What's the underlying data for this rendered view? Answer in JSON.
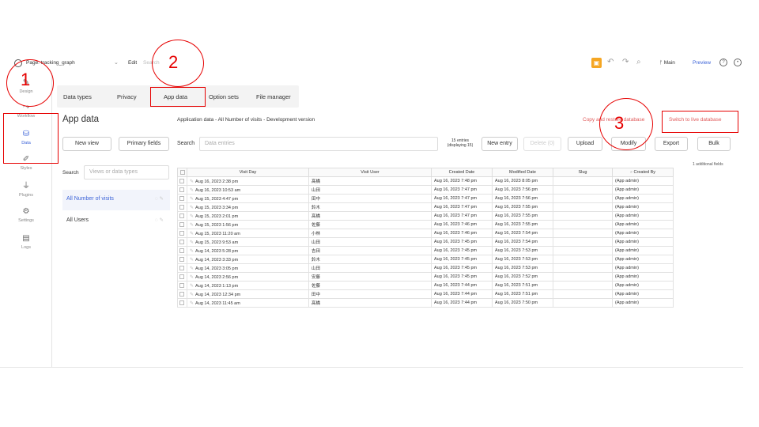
{
  "topbar": {
    "page_label": "Page: tracking_graph",
    "page_select_icon": "chevron-down-icon",
    "edit": "Edit",
    "search": "Search",
    "branch": "Main",
    "preview": "Preview"
  },
  "rail": [
    {
      "label": "Design",
      "icon": "design-icon"
    },
    {
      "label": "Workflow",
      "icon": "workflow-icon"
    },
    {
      "label": "Data",
      "icon": "database-icon"
    },
    {
      "label": "Styles",
      "icon": "brush-icon"
    },
    {
      "label": "Plugins",
      "icon": "plug-icon"
    },
    {
      "label": "Settings",
      "icon": "gear-icon"
    },
    {
      "label": "Logs",
      "icon": "document-icon"
    }
  ],
  "tabs": [
    "Data types",
    "Privacy",
    "App data",
    "Option sets",
    "File manager"
  ],
  "sidebar": {
    "title": "App data",
    "new_view": "New view",
    "primary_fields": "Primary fields",
    "search_label": "Search",
    "search_placeholder": "Views or data types",
    "items": [
      "All Number of visits",
      "All Users"
    ]
  },
  "main": {
    "heading": "Application data - All Number of visits - Development version",
    "copy_link": "Copy and restore database",
    "switch_link": "Switch to live database",
    "search_label": "Search",
    "search_placeholder": "Data entries",
    "entries_count": "15 entries",
    "entries_displaying": "(displaying 15)",
    "buttons": {
      "new_entry": "New entry",
      "delete": "Delete (0)",
      "upload": "Upload",
      "modify": "Modify",
      "export": "Export",
      "bulk": "Bulk"
    },
    "additional_fields": "1 additional fields"
  },
  "table": {
    "columns": [
      "Visit Day",
      "Visit User",
      "Created Date",
      "Modified Date",
      "Slug",
      "Created By"
    ],
    "rows": [
      [
        "Aug 16, 2023 2:38 pm",
        "髙橋",
        "Aug 16, 2023 7:48 pm",
        "Aug 16, 2023 8:05 pm",
        "",
        "(App admin)"
      ],
      [
        "Aug 16, 2023 10:53 am",
        "山田",
        "Aug 16, 2023 7:47 pm",
        "Aug 16, 2023 7:56 pm",
        "",
        "(App admin)"
      ],
      [
        "Aug 15, 2023 4:47 pm",
        "田中",
        "Aug 16, 2023 7:47 pm",
        "Aug 16, 2023 7:56 pm",
        "",
        "(App admin)"
      ],
      [
        "Aug 15, 2023 3:34 pm",
        "鈴木",
        "Aug 16, 2023 7:47 pm",
        "Aug 16, 2023 7:55 pm",
        "",
        "(App admin)"
      ],
      [
        "Aug 15, 2023 2:01 pm",
        "髙橋",
        "Aug 16, 2023 7:47 pm",
        "Aug 16, 2023 7:55 pm",
        "",
        "(App admin)"
      ],
      [
        "Aug 15, 2023 1:56 pm",
        "佐藤",
        "Aug 16, 2023 7:46 pm",
        "Aug 16, 2023 7:55 pm",
        "",
        "(App admin)"
      ],
      [
        "Aug 15, 2023 11:20 am",
        "小林",
        "Aug 16, 2023 7:46 pm",
        "Aug 16, 2023 7:54 pm",
        "",
        "(App admin)"
      ],
      [
        "Aug 15, 2023 9:53 am",
        "山田",
        "Aug 16, 2023 7:45 pm",
        "Aug 16, 2023 7:54 pm",
        "",
        "(App admin)"
      ],
      [
        "Aug 14, 2023 5:28 pm",
        "吉田",
        "Aug 16, 2023 7:45 pm",
        "Aug 16, 2023 7:53 pm",
        "",
        "(App admin)"
      ],
      [
        "Aug 14, 2023 3:33 pm",
        "鈴木",
        "Aug 16, 2023 7:45 pm",
        "Aug 16, 2023 7:53 pm",
        "",
        "(App admin)"
      ],
      [
        "Aug 14, 2023 3:05 pm",
        "山田",
        "Aug 16, 2023 7:45 pm",
        "Aug 16, 2023 7:53 pm",
        "",
        "(App admin)"
      ],
      [
        "Aug 14, 2023 2:56 pm",
        "安藤",
        "Aug 16, 2023 7:45 pm",
        "Aug 16, 2023 7:52 pm",
        "",
        "(App admin)"
      ],
      [
        "Aug 14, 2023 1:13 pm",
        "佐藤",
        "Aug 16, 2023 7:44 pm",
        "Aug 16, 2023 7:51 pm",
        "",
        "(App admin)"
      ],
      [
        "Aug 14, 2023 12:34 pm",
        "田中",
        "Aug 16, 2023 7:44 pm",
        "Aug 16, 2023 7:51 pm",
        "",
        "(App admin)"
      ],
      [
        "Aug 14, 2023 11:45 am",
        "髙橋",
        "Aug 16, 2023 7:44 pm",
        "Aug 16, 2023 7:50 pm",
        "",
        "(App admin)"
      ]
    ]
  },
  "annotations": [
    "1",
    "2",
    "3"
  ],
  "colors": {
    "accent": "#3c63d8",
    "annotation": "#e60000",
    "link_red": "#e05a5a",
    "gift": "#f5a623"
  }
}
